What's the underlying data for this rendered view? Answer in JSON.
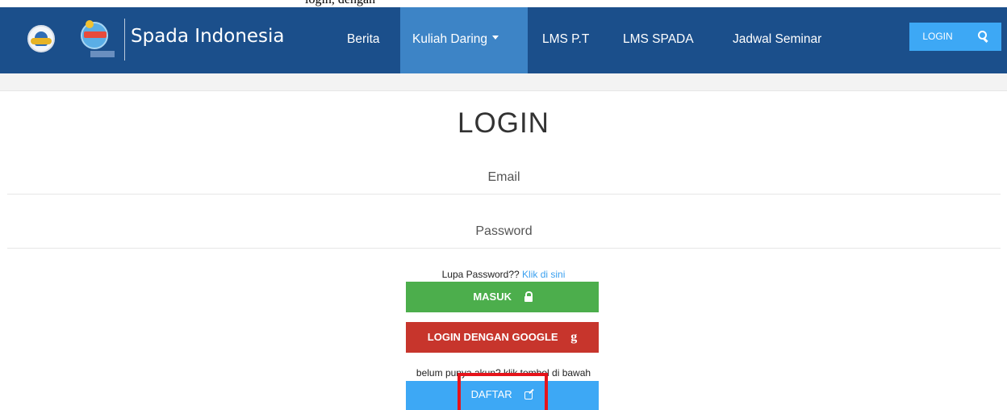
{
  "top_strip": {
    "clipped_text": "login, dengan"
  },
  "navbar": {
    "brand": "Spada Indonesia",
    "items": [
      {
        "label": "Berita"
      },
      {
        "label": "Kuliah Daring"
      },
      {
        "label": "LMS P.T"
      },
      {
        "label": "LMS SPADA"
      },
      {
        "label": "Jadwal Seminar"
      }
    ],
    "login_label": "LOGIN",
    "icons": {
      "search": "search-icon",
      "dropdown": "caret-down-icon"
    }
  },
  "login": {
    "title": "LOGIN",
    "email_placeholder": "Email",
    "password_placeholder": "Password",
    "forgot_text": "Lupa Password??",
    "forgot_link": "Klik di sini",
    "masuk_label": "MASUK",
    "google_label": "LOGIN DENGAN GOOGLE",
    "register_hint": "belum punya akun? klik tombol di bawah",
    "daftar_label": "DAFTAR",
    "icons": {
      "masuk": "unlock-icon",
      "google": "google-icon",
      "daftar": "edit-icon"
    }
  },
  "colors": {
    "navbar": "#1b4f8b",
    "nav_active": "#3d84c6",
    "accent_blue": "#3da8f5",
    "green": "#4cae4c",
    "red": "#c7352c",
    "highlight": "#e5141b",
    "link": "#3aa0ef"
  }
}
